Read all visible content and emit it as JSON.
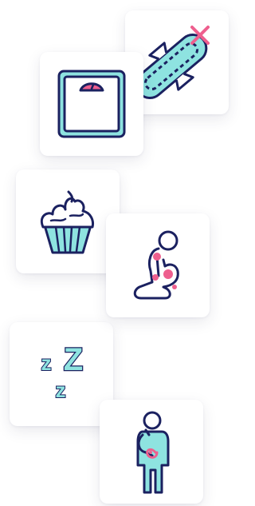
{
  "cards": [
    {
      "icon": "sanitary-pad-crossed-icon"
    },
    {
      "icon": "weight-scale-icon"
    },
    {
      "icon": "cupcake-icon"
    },
    {
      "icon": "knee-joint-pain-icon"
    },
    {
      "icon": "sleep-zzz-icon"
    },
    {
      "icon": "stomach-ache-icon"
    }
  ],
  "sleep": {
    "big_z": "Z",
    "small_z1": "z",
    "small_z2": "z"
  },
  "colors": {
    "outline": "#1b2160",
    "teal_fill": "#8ee3e0",
    "pink_accent": "#ee5f8e",
    "card_background": "#ffffff"
  }
}
